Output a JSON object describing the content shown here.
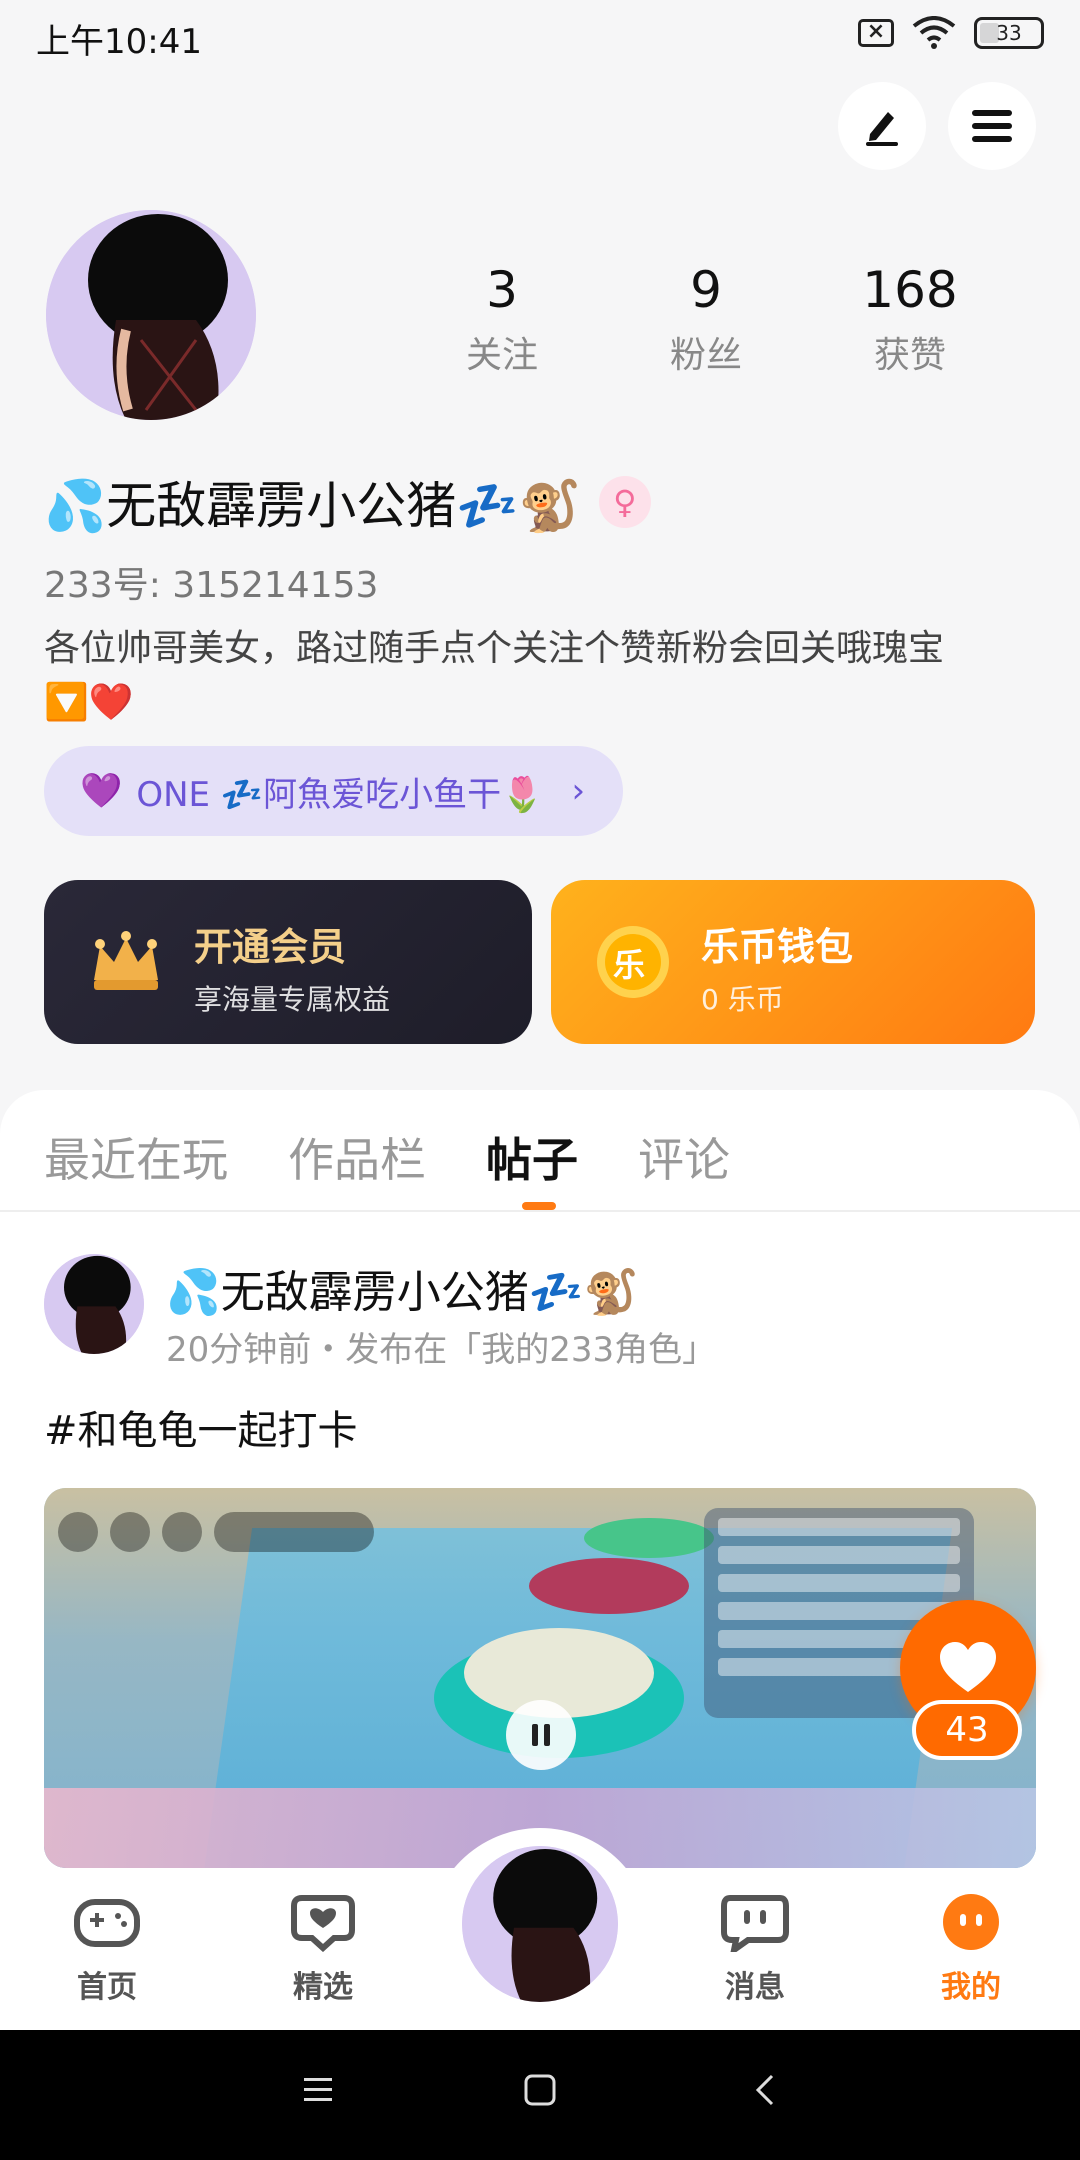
{
  "status_bar": {
    "time": "上午10:41",
    "battery": "33"
  },
  "profile": {
    "stats": [
      {
        "value": "3",
        "label": "关注"
      },
      {
        "value": "9",
        "label": "粉丝"
      },
      {
        "value": "168",
        "label": "获赞"
      }
    ],
    "name": "💦无敌霹雳小公猪💤🐒",
    "gender_symbol": "♀",
    "uid": "233号: 315214153",
    "bio": "各位帅哥美女，路过随手点个关注个赞新粉会回关哦瑰宝🔽❤️",
    "tag": {
      "icon": "💜",
      "text": "ONE 💤阿魚爱吃小鱼干🌷"
    }
  },
  "cards": {
    "vip": {
      "title": "开通会员",
      "subtitle": "享海量专属权益"
    },
    "wallet": {
      "title": "乐币钱包",
      "subtitle": "0 乐币",
      "coin_char": "乐"
    }
  },
  "tabs": [
    {
      "label": "最近在玩",
      "active": false
    },
    {
      "label": "作品栏",
      "active": false
    },
    {
      "label": "帖子",
      "active": true
    },
    {
      "label": "评论",
      "active": false
    }
  ],
  "post": {
    "author": "💦无敌霹雳小公猪💤🐒",
    "meta": "20分钟前・发布在「我的233角色」",
    "text": "#和龟龟一起打卡",
    "likes": "43"
  },
  "bottom_nav": [
    {
      "label": "首页",
      "icon": "gamepad-icon"
    },
    {
      "label": "精选",
      "icon": "heart-chat-icon"
    },
    {
      "label": "",
      "icon": "avatar"
    },
    {
      "label": "消息",
      "icon": "message-icon"
    },
    {
      "label": "我的",
      "icon": "profile-face-icon",
      "active": true
    }
  ],
  "colors": {
    "accent": "#ff7a12",
    "tag_bg": "#e4e0f8",
    "tag_text": "#6b55d6"
  }
}
